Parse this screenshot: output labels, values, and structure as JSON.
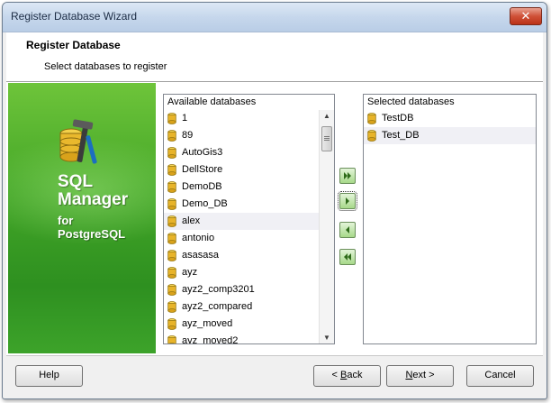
{
  "window": {
    "title": "Register Database Wizard"
  },
  "header": {
    "title": "Register Database",
    "subtitle": "Select databases to register"
  },
  "banner": {
    "product_line1": "SQL",
    "product_line2": "Manager",
    "product_line3": "for",
    "product_line4": "PostgreSQL"
  },
  "available": {
    "header": "Available databases",
    "items": [
      "1",
      "89",
      "AutoGis3",
      "DellStore",
      "DemoDB",
      "Demo_DB",
      "alex",
      "antonio",
      "asasasa",
      "ayz",
      "ayz2_comp3201",
      "ayz2_compared",
      "ayz_moved",
      "ayz_moved2"
    ]
  },
  "selected": {
    "header": "Selected databases",
    "items": [
      "TestDB",
      "Test_DB"
    ]
  },
  "footer": {
    "help": "Help",
    "back_prefix": "< ",
    "back_letter": "B",
    "back_rest": "ack",
    "next_letter": "N",
    "next_rest": "ext >",
    "cancel": "Cancel"
  },
  "colors": {
    "banner": "#43a627",
    "selected_row": "#f0f0f5"
  }
}
